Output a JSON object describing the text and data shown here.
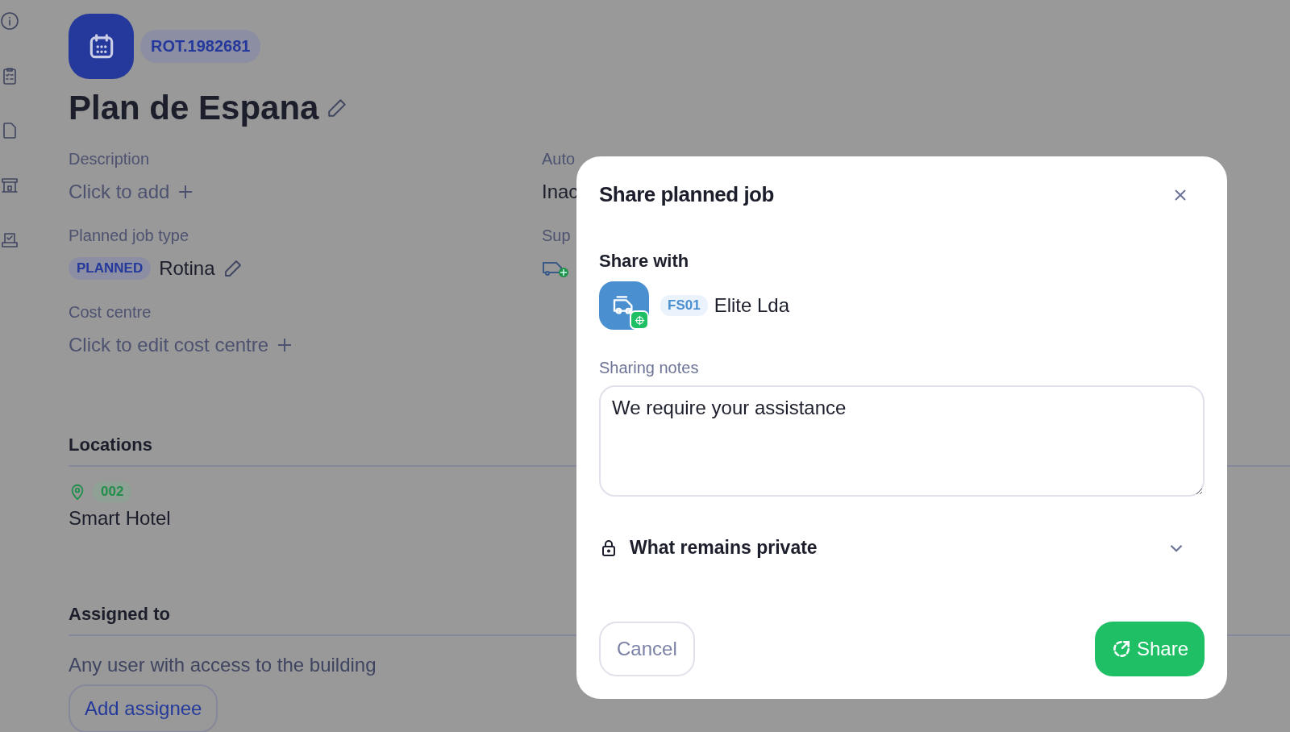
{
  "header": {
    "code": "ROT.1982681",
    "title": "Plan de Espana"
  },
  "fields": [
    {
      "label": "Description",
      "value": "Click to add",
      "kind": "add"
    },
    {
      "label": "Planned job type",
      "badge": "PLANNED",
      "value": "Rotina",
      "kind": "type"
    },
    {
      "label": "Cost centre",
      "value": "Click to edit cost centre",
      "kind": "add"
    }
  ],
  "side_fields": [
    {
      "label": "Auto",
      "value": "Inac",
      "kind": "text"
    },
    {
      "label": "Sup",
      "kind": "supplier"
    }
  ],
  "locations": {
    "heading": "Locations",
    "items": [
      {
        "code": "002",
        "name": "Smart Hotel"
      }
    ]
  },
  "assigned": {
    "heading": "Assigned to",
    "text": "Any user with access to the building",
    "button": "Add assignee"
  },
  "modal": {
    "title": "Share planned job",
    "share_with": "Share with",
    "recipient": {
      "code": "FS01",
      "name": "Elite Lda"
    },
    "notes_label": "Sharing notes",
    "notes_value": "We require your assistance",
    "private": {
      "label": "What remains private",
      "expanded": false
    },
    "cancel": "Cancel",
    "share": "Share"
  }
}
